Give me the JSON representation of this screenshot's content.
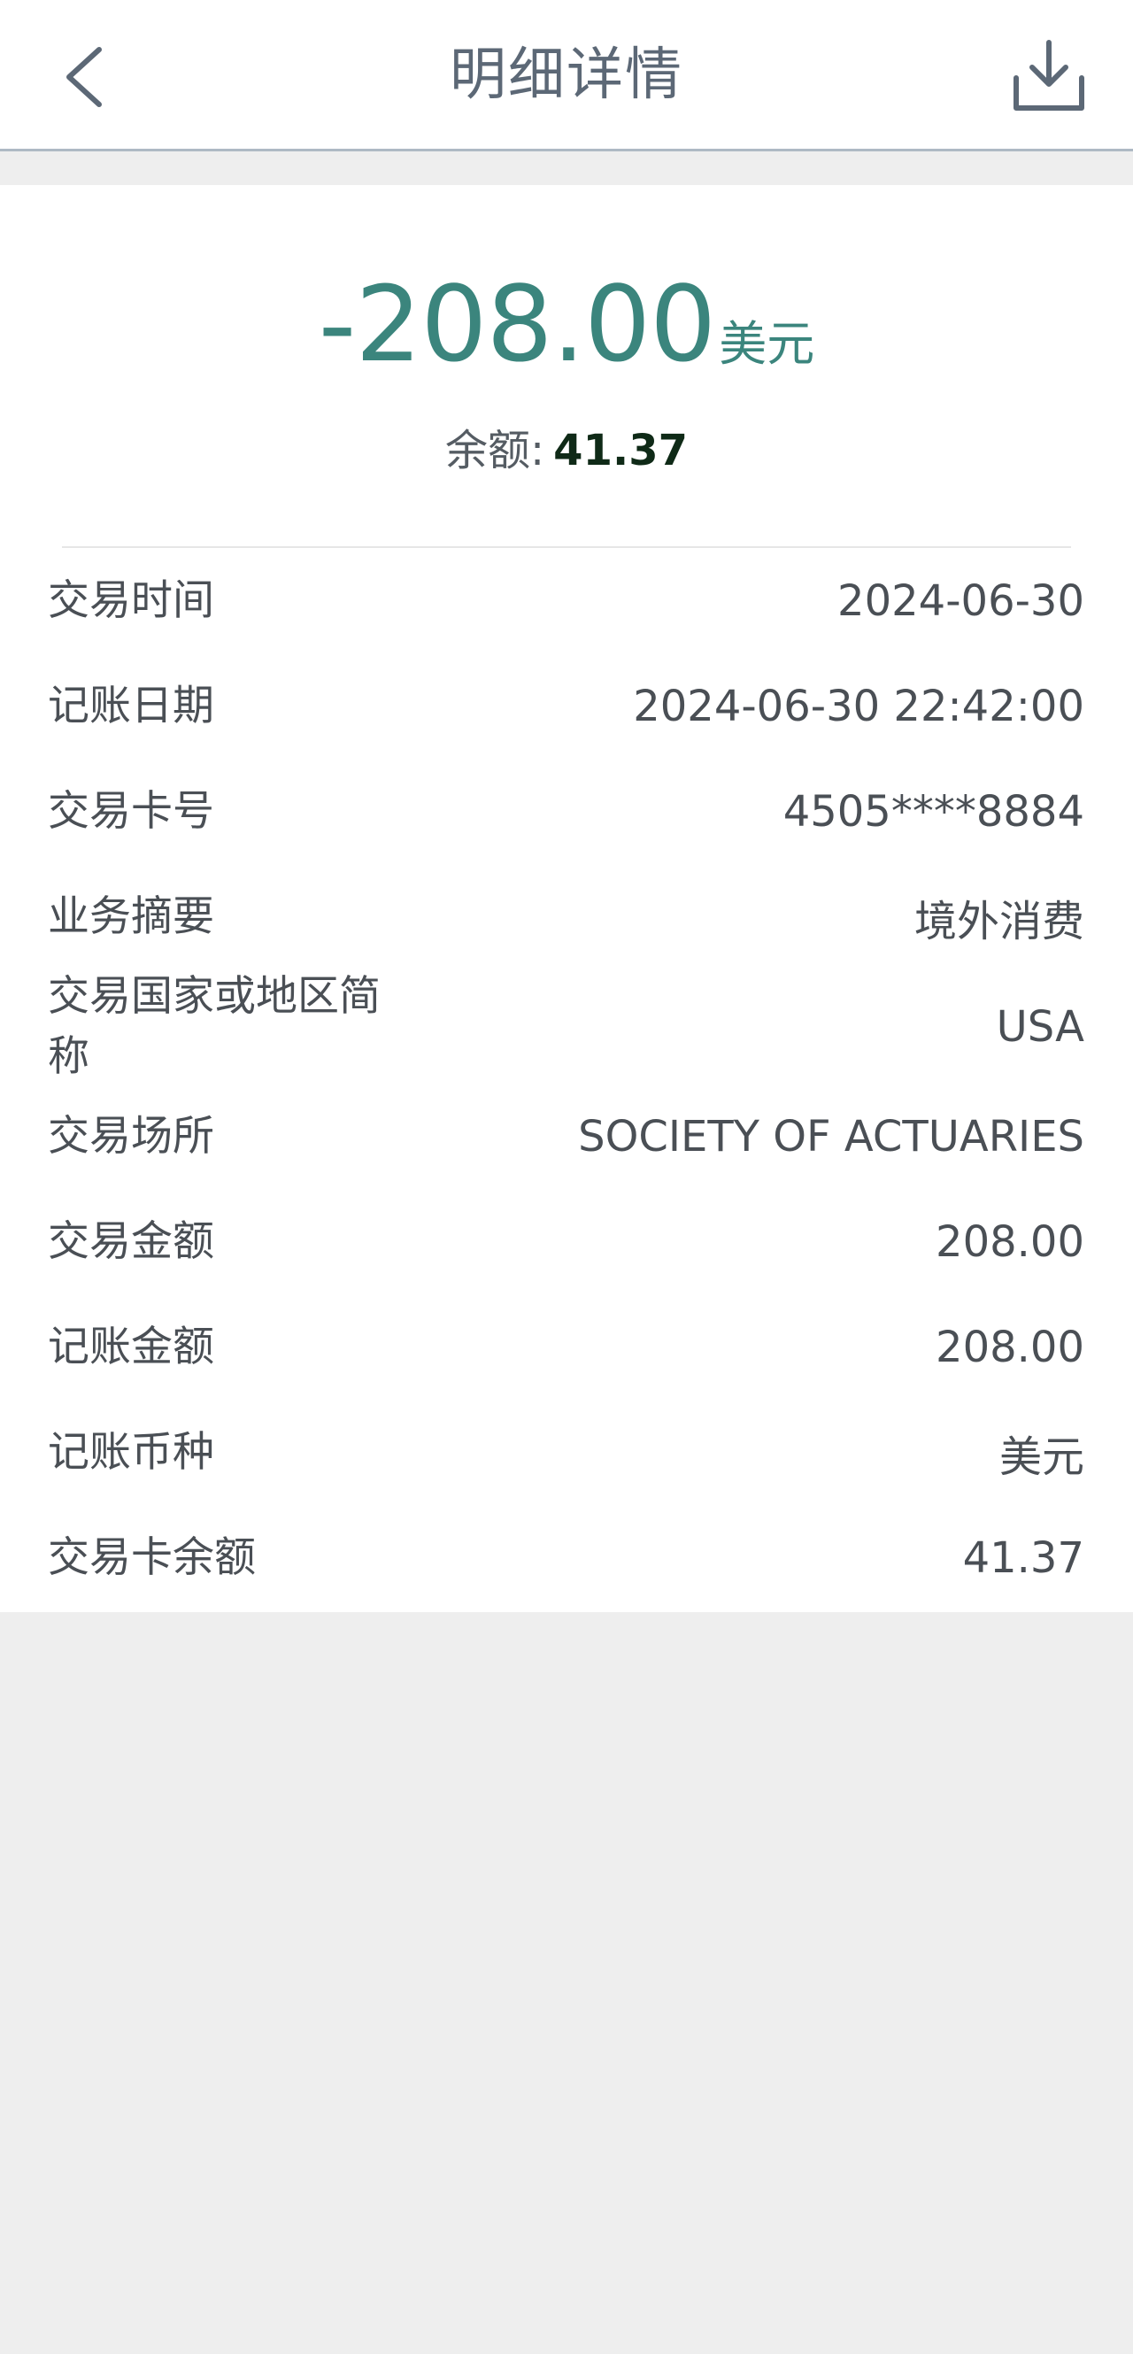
{
  "header": {
    "title": "明细详情",
    "back_icon": "chevron-left-icon",
    "download_icon": "download-icon"
  },
  "summary": {
    "amount": "-208.00",
    "currency": "美元",
    "balance_label": "余额:",
    "balance_value": "41.37"
  },
  "details": [
    {
      "label": "交易时间",
      "value": "2024-06-30"
    },
    {
      "label": "记账日期",
      "value": "2024-06-30 22:42:00"
    },
    {
      "label": "交易卡号",
      "value": "4505****8884"
    },
    {
      "label": "业务摘要",
      "value": "境外消费"
    },
    {
      "label": "交易国家或地区简称",
      "value": "USA"
    },
    {
      "label": "交易场所",
      "value": "SOCIETY OF ACTUARIES"
    },
    {
      "label": "交易金额",
      "value": "208.00"
    },
    {
      "label": "记账金额",
      "value": "208.00"
    },
    {
      "label": "记账币种",
      "value": "美元"
    },
    {
      "label": "交易卡余额",
      "value": "41.37"
    }
  ],
  "colors": {
    "amount": "#3b857d",
    "balance_value": "#0f2a17",
    "header_title": "#5c6876",
    "icon": "#5c6876",
    "background": "#eeeeee"
  }
}
